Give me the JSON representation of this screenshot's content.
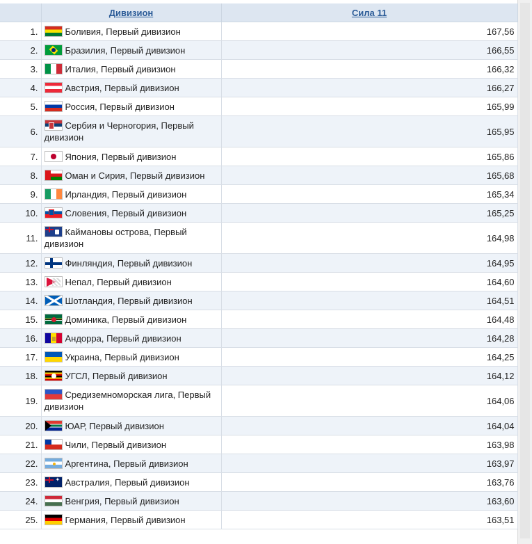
{
  "headers": {
    "division": "Дивизион",
    "strength": "Сила 11"
  },
  "rows": [
    {
      "rank": "1.",
      "name": "Боливия, Первый дивизион",
      "value": "167,56",
      "flag": "bolivia-flag-icon"
    },
    {
      "rank": "2.",
      "name": "Бразилия, Первый дивизион",
      "value": "166,55",
      "flag": "brazil-flag-icon"
    },
    {
      "rank": "3.",
      "name": "Италия, Первый дивизион",
      "value": "166,32",
      "flag": "italy-flag-icon"
    },
    {
      "rank": "4.",
      "name": "Австрия, Первый дивизион",
      "value": "166,27",
      "flag": "austria-flag-icon"
    },
    {
      "rank": "5.",
      "name": "Россия, Первый дивизион",
      "value": "165,99",
      "flag": "russia-flag-icon"
    },
    {
      "rank": "6.",
      "name": "Сербия и Черногория, Первый дивизион",
      "value": "165,95",
      "flag": "serbia-flag-icon"
    },
    {
      "rank": "7.",
      "name": "Япония, Первый дивизион",
      "value": "165,86",
      "flag": "japan-flag-icon"
    },
    {
      "rank": "8.",
      "name": "Оман и Сирия, Первый дивизион",
      "value": "165,68",
      "flag": "oman-flag-icon"
    },
    {
      "rank": "9.",
      "name": "Ирландия, Первый дивизион",
      "value": "165,34",
      "flag": "ireland-flag-icon"
    },
    {
      "rank": "10.",
      "name": "Словения, Первый дивизион",
      "value": "165,25",
      "flag": "slovenia-flag-icon"
    },
    {
      "rank": "11.",
      "name": "Каймановы острова, Первый дивизион",
      "value": "164,98",
      "flag": "cayman-islands-flag-icon"
    },
    {
      "rank": "12.",
      "name": "Финляндия, Первый дивизион",
      "value": "164,95",
      "flag": "finland-flag-icon"
    },
    {
      "rank": "13.",
      "name": "Непал, Первый дивизион",
      "value": "164,60",
      "flag": "nepal-flag-icon"
    },
    {
      "rank": "14.",
      "name": "Шотландия, Первый дивизион",
      "value": "164,51",
      "flag": "scotland-flag-icon"
    },
    {
      "rank": "15.",
      "name": "Доминика, Первый дивизион",
      "value": "164,48",
      "flag": "dominica-flag-icon"
    },
    {
      "rank": "16.",
      "name": "Андорра, Первый дивизион",
      "value": "164,28",
      "flag": "andorra-flag-icon"
    },
    {
      "rank": "17.",
      "name": "Украина, Первый дивизион",
      "value": "164,25",
      "flag": "ukraine-flag-icon"
    },
    {
      "rank": "18.",
      "name": "УГСЛ, Первый дивизион",
      "value": "164,12",
      "flag": "ugsl-flag-icon"
    },
    {
      "rank": "19.",
      "name": "Средиземноморская лига, Первый дивизион",
      "value": "164,06",
      "flag": "mediterranean-league-flag-icon"
    },
    {
      "rank": "20.",
      "name": "ЮАР, Первый дивизион",
      "value": "164,04",
      "flag": "south-africa-flag-icon"
    },
    {
      "rank": "21.",
      "name": "Чили, Первый дивизион",
      "value": "163,98",
      "flag": "chile-flag-icon"
    },
    {
      "rank": "22.",
      "name": "Аргентина, Первый дивизион",
      "value": "163,97",
      "flag": "argentina-flag-icon"
    },
    {
      "rank": "23.",
      "name": "Австралия, Первый дивизион",
      "value": "163,76",
      "flag": "australia-flag-icon"
    },
    {
      "rank": "24.",
      "name": "Венгрия, Первый дивизион",
      "value": "163,60",
      "flag": "hungary-flag-icon"
    },
    {
      "rank": "25.",
      "name": "Германия, Первый дивизион",
      "value": "163,51",
      "flag": "germany-flag-icon"
    }
  ]
}
